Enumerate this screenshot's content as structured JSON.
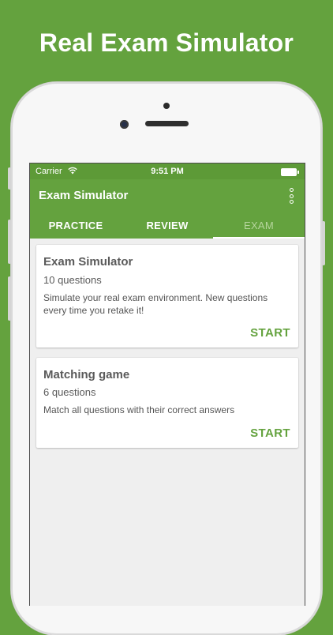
{
  "promo": {
    "title": "Real Exam Simulator"
  },
  "status_bar": {
    "carrier": "Carrier",
    "time": "9:51 PM"
  },
  "app_bar": {
    "title": "Exam Simulator"
  },
  "tabs": [
    {
      "label": "PRACTICE",
      "active": false
    },
    {
      "label": "REVIEW",
      "active": false
    },
    {
      "label": "EXAM",
      "active": true
    }
  ],
  "cards": [
    {
      "title": "Exam Simulator",
      "count": "10 questions",
      "description": "Simulate your real exam environment. New questions every time you retake it!",
      "action": "START"
    },
    {
      "title": "Matching game",
      "count": "6 questions",
      "description": "Match all questions with their correct answers",
      "action": "START"
    }
  ],
  "icons": {
    "wifi": "wifi-icon",
    "battery": "battery-icon",
    "overflow": "overflow-menu-icon"
  },
  "colors": {
    "brand_green": "#64a23e",
    "status_green": "#5d9a37",
    "background": "#efefef"
  }
}
